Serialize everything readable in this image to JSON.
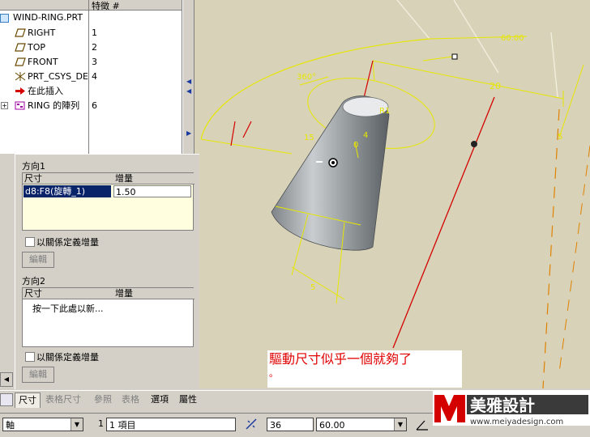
{
  "model_tree": {
    "header_feature_col": "特徵 #",
    "part_name": "WIND-RING.PRT",
    "items": [
      {
        "name": "RIGHT",
        "feature": "1",
        "icon": "datum-plane-icon"
      },
      {
        "name": "TOP",
        "feature": "2",
        "icon": "datum-plane-icon"
      },
      {
        "name": "FRONT",
        "feature": "3",
        "icon": "datum-plane-icon"
      },
      {
        "name": "PRT_CSYS_DE",
        "feature": "4",
        "icon": "csys-icon"
      },
      {
        "name": "在此插入",
        "feature": "",
        "icon": "insert-here-arrow-icon"
      },
      {
        "name": "RING 的陣列",
        "feature": "6",
        "icon": "pattern-icon"
      }
    ]
  },
  "pattern_panel": {
    "direction1": {
      "title": "方向1",
      "col_dim": "尺寸",
      "col_inc": "增量",
      "row_dim": "d8:F8(旋轉_1)",
      "row_inc": "1.50",
      "relation_label": "以關係定義增量",
      "edit_label": "編輯"
    },
    "direction2": {
      "title": "方向2",
      "col_dim": "尺寸",
      "col_inc": "增量",
      "placeholder": "按一下此處以新...",
      "relation_label": "以關係定義增量",
      "edit_label": "編輯"
    }
  },
  "tabs": [
    "尺寸",
    "表格尺寸",
    "參照",
    "表格",
    "選項",
    "屬性"
  ],
  "dashboard": {
    "pattern_type": "軸",
    "count1_label": "1",
    "count1_value": "1 項目",
    "count2_value": "36",
    "angle_value": "60.00"
  },
  "graphics": {
    "dim_60": "60.00",
    "dim_20": "20",
    "dim_360": "360°",
    "dim_15": "15",
    "dim_5": "5",
    "dim_r1": "R1",
    "dim_4": "4",
    "dim_0": "0",
    "dim_5b": "5"
  },
  "annotation": {
    "text_line1": "驅動尺寸似乎一個就夠了",
    "text_line2": "。"
  },
  "logo": {
    "brand": "美雅設計",
    "url": "www.meiyadesign.com"
  },
  "colors": {
    "graphics_bg": "#d8d3b8",
    "dimension": "#e6e600",
    "centerline": "#d40000",
    "annotation": "#e00000"
  }
}
